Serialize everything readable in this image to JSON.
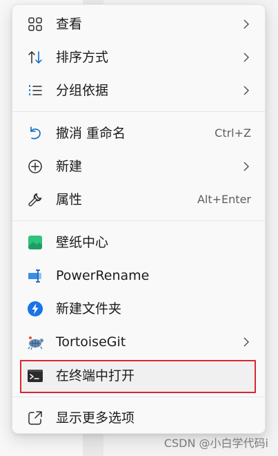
{
  "context_menu": {
    "items": [
      {
        "label": "查看",
        "icon": "grid-icon",
        "submenu": true
      },
      {
        "label": "排序方式",
        "icon": "sort-icon",
        "submenu": true
      },
      {
        "label": "分组依据",
        "icon": "group-list-icon",
        "submenu": true
      },
      {
        "label": "撤消 重命名",
        "icon": "undo-icon",
        "shortcut": "Ctrl+Z"
      },
      {
        "label": "新建",
        "icon": "plus-circle-icon",
        "submenu": true
      },
      {
        "label": "属性",
        "icon": "wrench-icon",
        "shortcut": "Alt+Enter"
      },
      {
        "label": "壁纸中心",
        "icon": "wallpaper-icon"
      },
      {
        "label": "PowerRename",
        "icon": "powerrename-icon"
      },
      {
        "label": "新建文件夹",
        "icon": "new-folder-app-icon"
      },
      {
        "label": "TortoiseGit",
        "icon": "tortoisegit-icon",
        "submenu": true
      },
      {
        "label": "在终端中打开",
        "icon": "terminal-icon",
        "highlighted": true
      },
      {
        "label": "显示更多选项",
        "icon": "share-more-icon"
      }
    ]
  },
  "colors": {
    "highlight_border": "#d9262e",
    "menu_bg": "#f9f9f9",
    "accent_blue": "#0067c0",
    "wallpaper_green": "#2ec27e"
  },
  "watermark": "CSDN @小白学代码i"
}
